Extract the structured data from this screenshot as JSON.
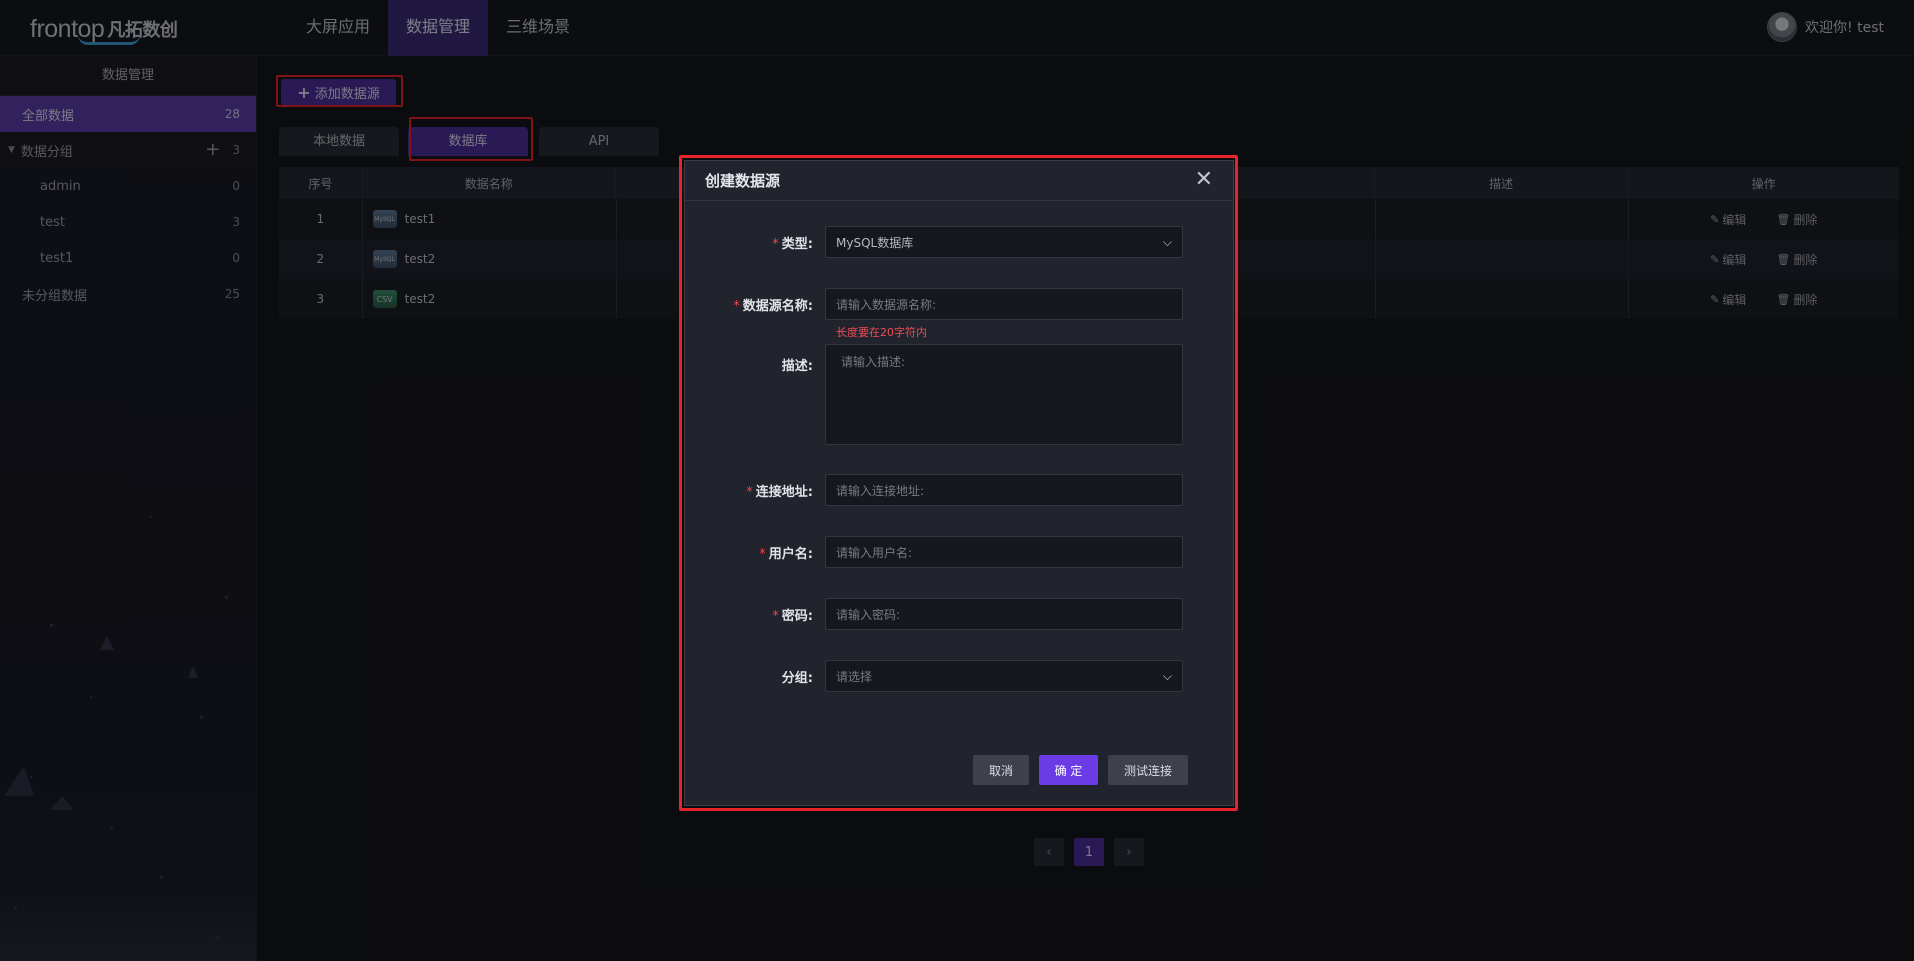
{
  "header": {
    "logo_text": "frontop",
    "logo_cn": "凡拓数创",
    "nav": [
      {
        "label": "大屏应用"
      },
      {
        "label": "数据管理"
      },
      {
        "label": "三维场景"
      }
    ],
    "welcome": "欢迎你! test"
  },
  "sidebar": {
    "title": "数据管理",
    "all": {
      "label": "全部数据",
      "count": "28"
    },
    "group": {
      "label": "数据分组",
      "count": "3"
    },
    "children": [
      {
        "label": "admin",
        "count": "0"
      },
      {
        "label": "test",
        "count": "3"
      },
      {
        "label": "test1",
        "count": "0"
      }
    ],
    "ungrouped": {
      "label": "未分组数据",
      "count": "25"
    }
  },
  "main": {
    "add_button": "添加数据源",
    "tabs": [
      {
        "label": "本地数据"
      },
      {
        "label": "数据库"
      },
      {
        "label": "API"
      }
    ],
    "columns": [
      "序号",
      "数据名称",
      "",
      "描述",
      "操作"
    ],
    "rows": [
      {
        "no": "1",
        "icon": "MySQL",
        "name": "test1"
      },
      {
        "no": "2",
        "icon": "MySQL",
        "name": "test2"
      },
      {
        "no": "3",
        "icon": "CSV",
        "name": "test2"
      }
    ],
    "edit_label": "编辑",
    "delete_label": "删除",
    "pagination": {
      "current": "1"
    }
  },
  "modal": {
    "title": "创建数据源",
    "fields": {
      "type": {
        "label": "类型:",
        "value": "MySQL数据库"
      },
      "name": {
        "label": "数据源名称:",
        "placeholder": "请输入数据源名称:",
        "error": "长度要在20字符内"
      },
      "desc": {
        "label": "描述:",
        "placeholder": "请输入描述:"
      },
      "url": {
        "label": "连接地址:",
        "placeholder": "请输入连接地址:"
      },
      "user": {
        "label": "用户名:",
        "placeholder": "请输入用户名:"
      },
      "pwd": {
        "label": "密码:",
        "placeholder": "请输入密码:"
      },
      "group": {
        "label": "分组:",
        "placeholder": "请选择"
      }
    },
    "buttons": {
      "cancel": "取消",
      "ok": "确 定",
      "test": "测试连接"
    }
  },
  "colors": {
    "accent": "#4b2f9a",
    "primary": "#6b3ce6",
    "highlight": "#e8232a",
    "error": "#ef4b55"
  }
}
